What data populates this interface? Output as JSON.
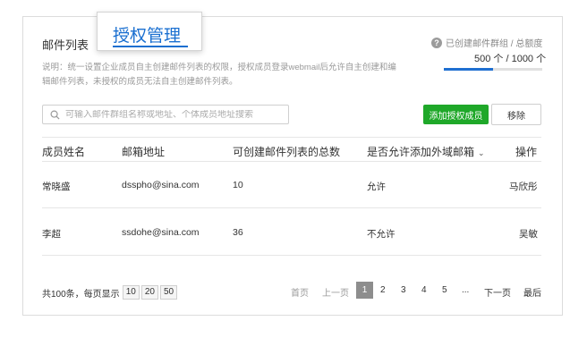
{
  "header": {
    "section_title": "邮件列表",
    "active_tab_label": "授权管理",
    "description": "说明：统一设置企业成员自主创建邮件列表的权限，授权成员登录webmail后允许自主创建和编辑邮件列表，未授权的成员无法自主创建邮件列表。"
  },
  "quota": {
    "label": "已创建邮件群组 / 总额度",
    "value_text": "500 个 / 1000 个",
    "used": 500,
    "total": 1000,
    "bar_color": "#1f6fd1"
  },
  "toolbar": {
    "search_placeholder": "可输入邮件群组名称或地址、个体成员地址搜索",
    "add_label": "添加授权成员",
    "remove_label": "移除",
    "add_color": "#1fa829"
  },
  "table": {
    "columns": [
      "成员姓名",
      "邮箱地址",
      "可创建邮件列表的总数",
      "是否允许添加外域邮箱",
      "操作"
    ],
    "rows": [
      {
        "name": "常晓盛",
        "email": "dsspho@sina.com",
        "count": "10",
        "external": "允许",
        "action": "马欣彤"
      },
      {
        "name": "李超",
        "email": "ssdohe@sina.com",
        "count": "36",
        "external": "不允许",
        "action": "吴敏"
      }
    ]
  },
  "pagination": {
    "total_text": "共100条，每页显示",
    "page_sizes": [
      "10",
      "20",
      "50"
    ],
    "first": "首页",
    "prev": "上一页",
    "pages": [
      "1",
      "2",
      "3",
      "4",
      "5"
    ],
    "ellipsis": "...",
    "next": "下一页",
    "last": "最后",
    "current_page": 1
  }
}
